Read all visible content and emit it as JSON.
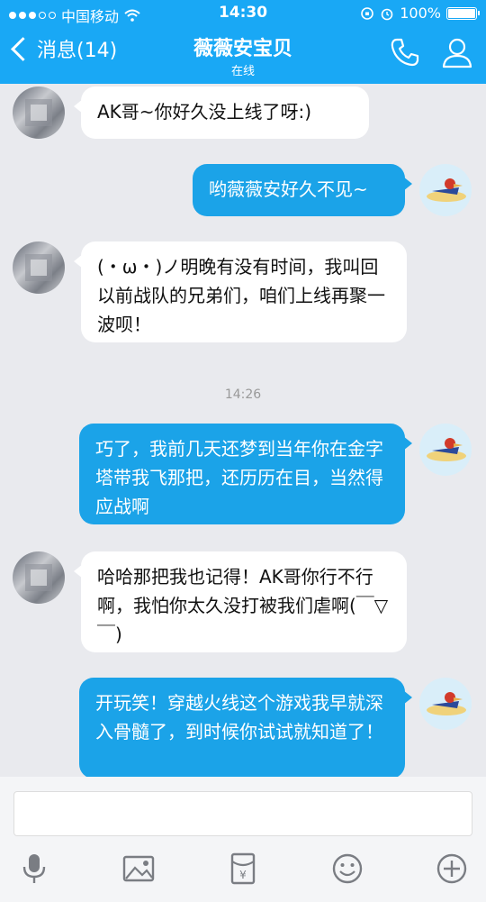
{
  "status_bar": {
    "carrier": "中国移动",
    "time": "14:30",
    "battery": "100%",
    "battery_level": 1.0
  },
  "nav": {
    "back_label": "消息(14)",
    "title": "薇薇安宝贝",
    "subtitle": "在线"
  },
  "messages": [
    {
      "from": "them",
      "text": "AK哥~你好久没上线了呀:)"
    },
    {
      "from": "me",
      "text": "哟薇薇安好久不见~"
    },
    {
      "from": "them",
      "text": "(・ω・)ノ明晚有没有时间，我叫回以前战队的兄弟们，咱们上线再聚一波呗！"
    },
    {
      "from": "me",
      "text": "巧了，我前几天还梦到当年你在金字塔带我飞那把，还历历在目，当然得应战啊"
    },
    {
      "from": "them",
      "text": "哈哈那把我也记得！AK哥你行不行啊，我怕你太久没打被我们虐啊(￣▽￣)"
    },
    {
      "from": "me",
      "text": "开玩笑！穿越火线这个游戏我早就深入骨髓了，到时候你试试就知道了！"
    }
  ],
  "timestamp": "14:26",
  "colors": {
    "header": "#19a8f5",
    "my_bubble": "#1ba3e8",
    "their_bubble": "#ffffff",
    "background": "#e9eaee"
  },
  "toolbar_icons": [
    "microphone-icon",
    "image-icon",
    "red-packet-icon",
    "emoji-icon",
    "plus-icon"
  ]
}
